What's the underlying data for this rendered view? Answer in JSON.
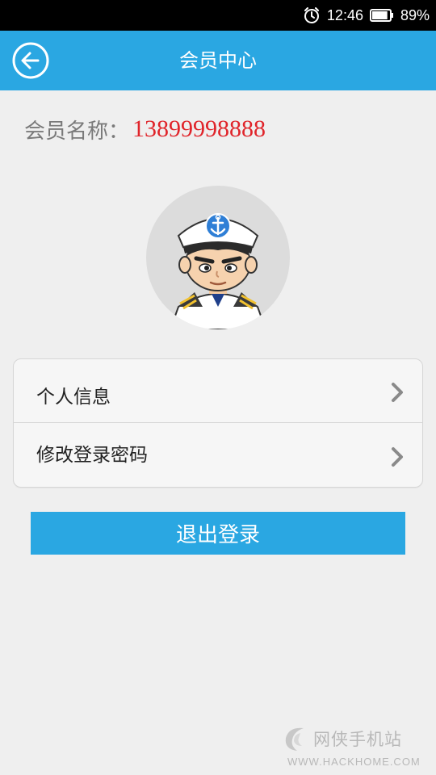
{
  "status_bar": {
    "time": "12:46",
    "battery": "89%",
    "battery_level": 0.89,
    "alarm_icon": "alarm-clock-icon",
    "battery_icon": "battery-icon"
  },
  "header": {
    "title": "会员中心",
    "back_icon": "circle-back-arrow-icon",
    "color": "#2aa7e2"
  },
  "member": {
    "label": "会员名称：",
    "value": "13899998888",
    "value_color": "#e0242a"
  },
  "avatar": {
    "icon": "sailor-captain-avatar"
  },
  "menu": {
    "items": [
      {
        "label": "个人信息",
        "icon": "chevron-right-icon"
      },
      {
        "label": "修改登录密码",
        "icon": "chevron-right-icon"
      }
    ]
  },
  "logout": {
    "label": "退出登录"
  },
  "watermark": {
    "name": "网侠手机站",
    "url": "WWW.HACKHOME.COM"
  }
}
